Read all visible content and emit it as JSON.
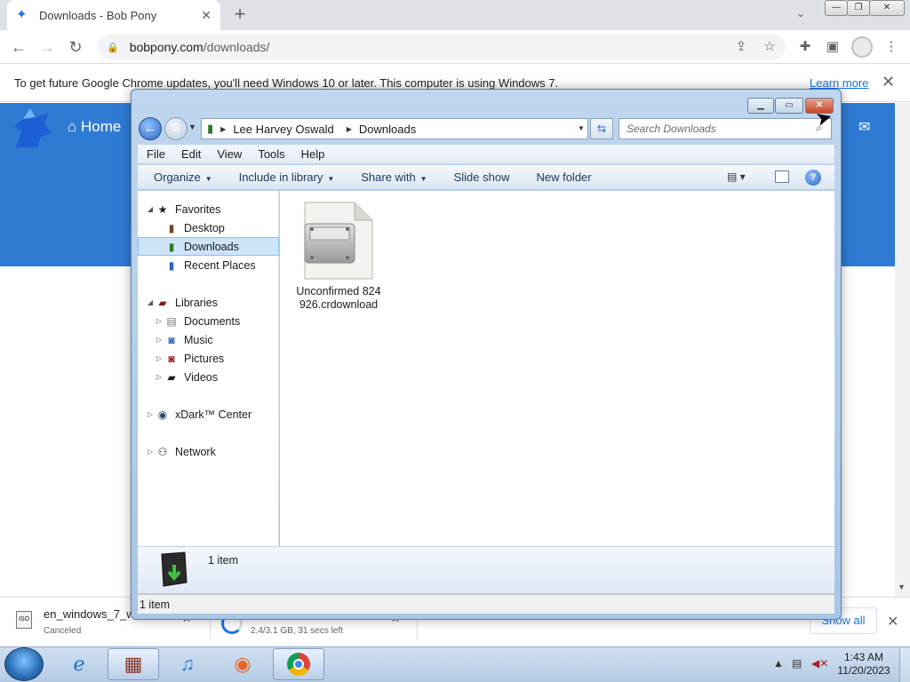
{
  "browser": {
    "tab": {
      "title": "Downloads - Bob Pony",
      "close": "✕"
    },
    "new_tab": "+",
    "url_host": "bobpony.com",
    "url_path": "/downloads/",
    "infobar": {
      "text": "To get future Google Chrome updates, you'll need Windows 10 or later. This computer is using Windows 7.",
      "link": "Learn more",
      "close": "✕"
    },
    "site": {
      "home": "Home"
    }
  },
  "explorer": {
    "address": [
      "Lee Harvey Oswald",
      "Downloads"
    ],
    "search_placeholder": "Search Downloads",
    "menu": [
      "File",
      "Edit",
      "View",
      "Tools",
      "Help"
    ],
    "commands": [
      "Organize",
      "Include in library",
      "Share with",
      "Slide show",
      "New folder"
    ],
    "nav": {
      "favorites": "Favorites",
      "desktop": "Desktop",
      "downloads": "Downloads",
      "recent": "Recent Places",
      "libraries": "Libraries",
      "documents": "Documents",
      "music": "Music",
      "pictures": "Pictures",
      "videos": "Videos",
      "xdark": "xDark™ Center",
      "network": "Network"
    },
    "file_label": "Unconfirmed 824926.crdownload",
    "details_text": "1 item",
    "status_text": "1 item"
  },
  "downloads_shelf": {
    "item1": {
      "name": "en_windows_7_w",
      "status": "Canceled"
    },
    "item2": {
      "status": "2.4/3.1 GB, 31 secs left"
    },
    "show_all": "Show all",
    "close": "✕"
  },
  "taskbar": {
    "time": "1:43 AM",
    "date": "11/20/2023"
  }
}
